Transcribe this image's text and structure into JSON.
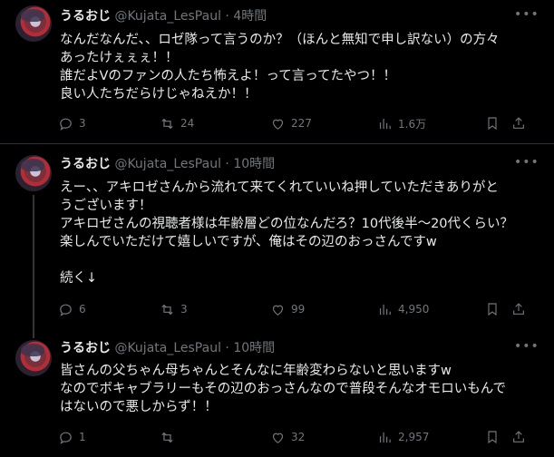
{
  "tweets": [
    {
      "name": "うるおじ",
      "handle": "@Kujata_LesPaul",
      "dot": "·",
      "time": "4時間",
      "text": "なんだなんだ、、ロゼ隊って言うのか？（ほんと無知で申し訳ない）の方々\nあったけぇぇぇ！！\n誰だよVのファンの人たち怖えよ！って言ってたやつ！！\n良い人たちだらけじゃねえか！！",
      "replies": "3",
      "reposts": "24",
      "likes": "227",
      "views": "1.6万"
    },
    {
      "name": "うるおじ",
      "handle": "@Kujata_LesPaul",
      "dot": "·",
      "time": "10時間",
      "text": "えー、、アキロゼさんから流れて来てくれていいね押していただきありがと\nうございます！\nアキロゼさんの視聴者様は年齢層どの位なんだろ？10代後半～20代くらい？\n楽しんでいただけて嬉しいですが、俺はその辺のおっさんですw\n\n続く↓",
      "replies": "6",
      "reposts": "3",
      "likes": "99",
      "views": "4,950"
    },
    {
      "name": "うるおじ",
      "handle": "@Kujata_LesPaul",
      "dot": "·",
      "time": "10時間",
      "text": "皆さんの父ちゃん母ちゃんとそんなに年齢変わらないと思いますw\nなのでボキャブラリーもその辺のおっさんなので普段そんなオモロいもんで\nはないので悪しからず！！",
      "replies": "1",
      "reposts": "",
      "likes": "32",
      "views": "2,957"
    }
  ],
  "icons": {
    "reply": "reply-icon",
    "repost": "repost-icon",
    "like": "heart-icon",
    "views": "views-icon",
    "bookmark": "bookmark-icon",
    "share": "share-icon",
    "more": "more-icon"
  },
  "colors": {
    "background": "#000000",
    "text": "#e7e9ea",
    "muted": "#71767b",
    "divider": "#2f3336"
  }
}
